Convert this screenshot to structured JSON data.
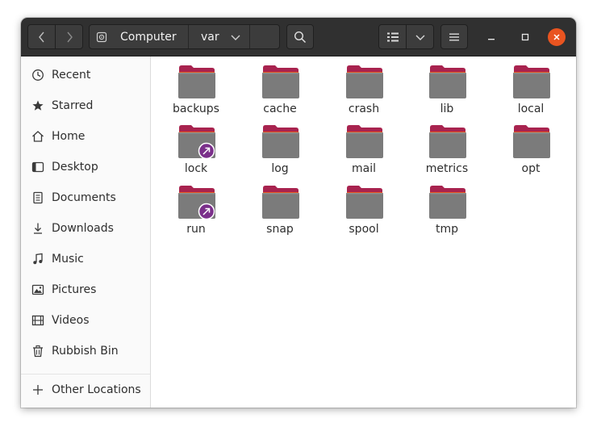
{
  "window": {
    "title": "var"
  },
  "header": {
    "back_icon": "chevron-left-icon",
    "forward_icon": "chevron-right-icon",
    "path": [
      {
        "label": "Computer",
        "icon": "drive-icon"
      },
      {
        "label": "var"
      }
    ],
    "search_icon": "search-icon",
    "view_icon": "list-view-icon",
    "view_options_icon": "chevron-down-icon",
    "menu_icon": "hamburger-menu-icon",
    "controls": [
      "minimize-icon",
      "maximize-icon",
      "close-icon"
    ],
    "close_color": "#e95420"
  },
  "sidebar": {
    "items": [
      {
        "label": "Recent",
        "icon": "clock-icon"
      },
      {
        "label": "Starred",
        "icon": "star-icon"
      },
      {
        "label": "Home",
        "icon": "home-icon"
      },
      {
        "label": "Desktop",
        "icon": "desktop-icon"
      },
      {
        "label": "Documents",
        "icon": "document-icon"
      },
      {
        "label": "Downloads",
        "icon": "download-icon"
      },
      {
        "label": "Music",
        "icon": "music-icon"
      },
      {
        "label": "Pictures",
        "icon": "picture-icon"
      },
      {
        "label": "Videos",
        "icon": "video-icon"
      },
      {
        "label": "Rubbish Bin",
        "icon": "trash-icon"
      }
    ],
    "other_locations": {
      "label": "Other Locations",
      "icon": "plus-icon"
    }
  },
  "files": [
    {
      "name": "backups",
      "link": false
    },
    {
      "name": "cache",
      "link": false
    },
    {
      "name": "crash",
      "link": false
    },
    {
      "name": "lib",
      "link": false
    },
    {
      "name": "local",
      "link": false
    },
    {
      "name": "lock",
      "link": true
    },
    {
      "name": "log",
      "link": false
    },
    {
      "name": "mail",
      "link": false
    },
    {
      "name": "metrics",
      "link": false
    },
    {
      "name": "opt",
      "link": false
    },
    {
      "name": "run",
      "link": true
    },
    {
      "name": "snap",
      "link": false
    },
    {
      "name": "spool",
      "link": false
    },
    {
      "name": "tmp",
      "link": false
    }
  ],
  "colors": {
    "folder_tab": "#a8234f",
    "folder_body": "#7b7b7b",
    "folder_edge": "#e95420",
    "symlink_badge": "#7a2f8a"
  }
}
